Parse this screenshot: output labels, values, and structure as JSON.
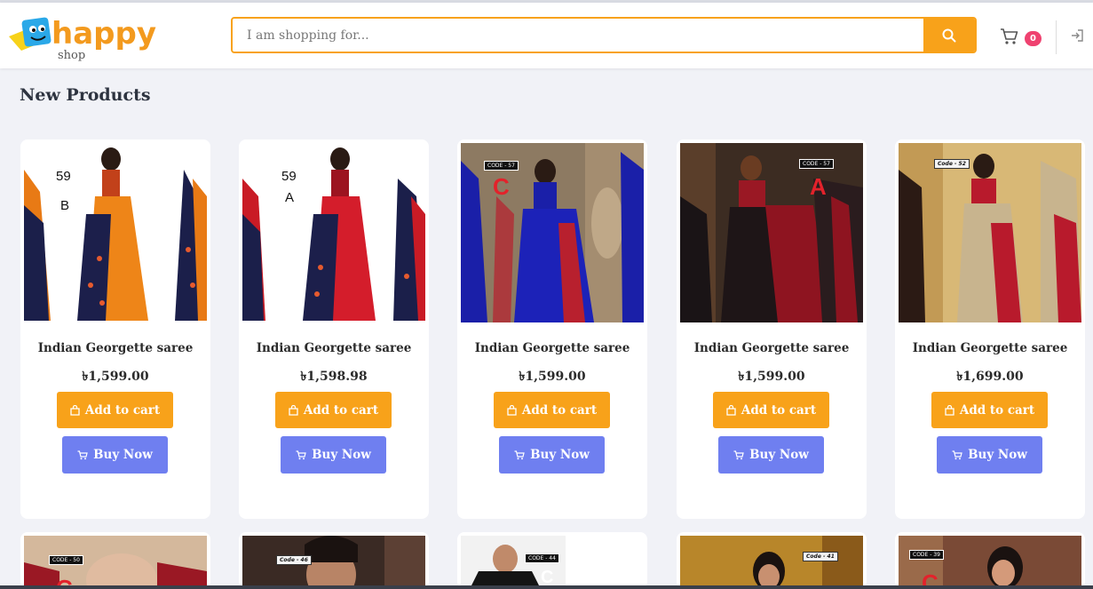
{
  "header": {
    "logo_text": "happy",
    "logo_sub": "shop",
    "search_placeholder": "I am shopping for...",
    "cart_count": "0"
  },
  "section": {
    "title": "New Products"
  },
  "products": [
    {
      "name": "Indian Georgette saree",
      "price": "৳1,599.00",
      "add_label": "Add to cart",
      "buy_label": "Buy Now",
      "img_text": [
        "59",
        "B"
      ]
    },
    {
      "name": "Indian Georgette saree",
      "price": "৳1,598.98",
      "add_label": "Add to cart",
      "buy_label": "Buy Now",
      "img_text": [
        "59",
        "A"
      ]
    },
    {
      "name": "Indian Georgette saree",
      "price": "৳1,599.00",
      "add_label": "Add to cart",
      "buy_label": "Buy Now",
      "img_text": [
        "CODE - 57",
        "C"
      ]
    },
    {
      "name": "Indian Georgette saree",
      "price": "৳1,599.00",
      "add_label": "Add to cart",
      "buy_label": "Buy Now",
      "img_text": [
        "CODE - 57",
        "A"
      ]
    },
    {
      "name": "Indian Georgette saree",
      "price": "৳1,699.00",
      "add_label": "Add to cart",
      "buy_label": "Buy Now",
      "img_text": [
        "Code - 52"
      ]
    }
  ],
  "products_row2": [
    {
      "img_text": [
        "CODE - 50",
        "C"
      ]
    },
    {
      "img_text": [
        "Code - 46"
      ]
    },
    {
      "img_text": [
        "CODE - 44",
        "C"
      ]
    },
    {
      "img_text": [
        "Code - 41"
      ]
    },
    {
      "img_text": [
        "CODE - 39",
        "C"
      ]
    }
  ],
  "colors": {
    "accent": "#f8a21a",
    "buy": "#6f7ff0",
    "badge": "#ef4270"
  },
  "icons": {
    "search": "search-icon",
    "cart": "cart-icon",
    "login": "sign-in-icon",
    "bag": "bag-icon",
    "cart_small": "cart-icon"
  }
}
